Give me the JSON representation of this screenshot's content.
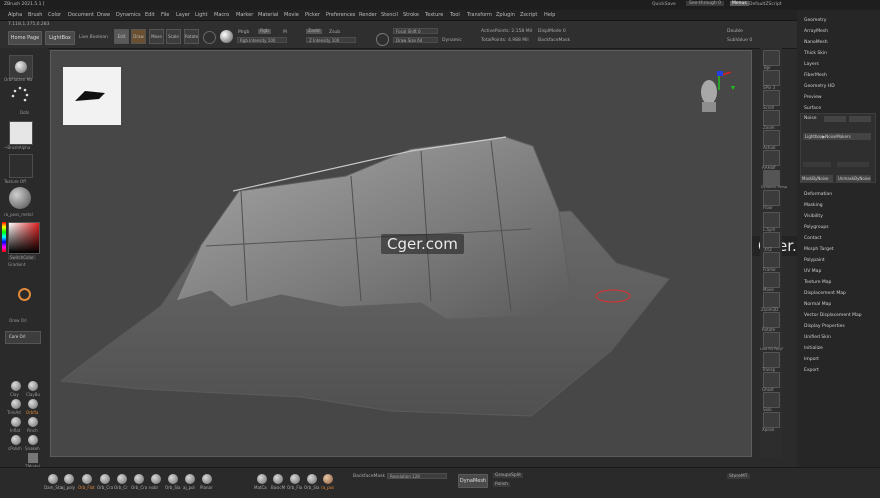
{
  "titlebar": {
    "title": "ZBrush 2021.5.1 [",
    "quicksave": "QuickSave",
    "see_through": "See-through  0",
    "menus": "Menus",
    "script": "DefaultZScript"
  },
  "menubar": [
    "Alpha",
    "Brush",
    "Color",
    "Document",
    "Draw",
    "Dynamics",
    "Edit",
    "File",
    "Layer",
    "Light",
    "Macro",
    "Marker",
    "Material",
    "Movie",
    "Picker",
    "Preferences",
    "Render",
    "Stencil",
    "Stroke",
    "Texture",
    "Tool",
    "Transform",
    "Zplugin",
    "Zscript",
    "Help"
  ],
  "toolbar": {
    "coords": "7.118,1.375,0.283",
    "home_page": "Home Page",
    "lightbox": "LightBox",
    "live_boolean": "Live Boolean",
    "edit": "Edit",
    "draw": "Draw",
    "move": "Move",
    "scale": "Scale",
    "rotate": "Rotate",
    "mrgb": "Mrgb",
    "rgb": "Rgb",
    "m": "M",
    "rgb_intensity": "Rgb Intensity 100",
    "zadd": "Zadd",
    "zsub": "Zsub",
    "z_intensity": "Z Intensity 100",
    "focal_shift": "Focal Shift 0",
    "draw_size": "Draw Size 64",
    "dynamic": "Dynamic",
    "active_points": "ActivePoints: 2.158 Mil",
    "total_points": "TotalPoints: 4.988 Mil",
    "spotlight_mode": "DisplMode 0",
    "backface_mask": "BackfaceMask",
    "double": "Double",
    "subvalue": "SubValue 0"
  },
  "leftpanel": {
    "brush_label": "OrbFlatten Ma",
    "stroke_label": "Dots",
    "alpha_label": "~BrushAlpha",
    "texture_label": "Texture Off",
    "material_label": "ra_poss_metal",
    "switch_color": "SwitchColor",
    "gradient": "Gradient",
    "orbit_label": "Orow Orl",
    "core_label": "Core Orl"
  },
  "left_brushes": [
    {
      "name": "Clay"
    },
    {
      "name": "ClayBu"
    },
    {
      "name": "TrimAd"
    },
    {
      "name": "Orbfla"
    },
    {
      "name": "Inflat"
    },
    {
      "name": "Pinch"
    },
    {
      "name": "cPolish"
    },
    {
      "name": "Snakeh"
    },
    {
      "name": "ZModel"
    },
    {
      "name": "Move"
    },
    {
      "name": "Orb_Cr"
    }
  ],
  "right_tools": [
    "Bpr",
    "SPix 3",
    "Scroll",
    "Zoom",
    "Actual",
    "AAHalf",
    "Dynamic Persp",
    "Floor",
    "L.Sym",
    "XYZ",
    "Frame",
    "Move",
    "Zoom3D",
    "Rotate",
    "Line Fill PolyF",
    "Transp",
    "Ghost",
    "Solo",
    "Xpose"
  ],
  "right_menu": {
    "items": [
      "Geometry",
      "ArrayMesh",
      "NanoMesh",
      "Thick Skin",
      "Layers",
      "FiberMesh",
      "Geometry HD",
      "Preview",
      "Surface"
    ],
    "surface_noise": "Noise",
    "surface_btn": "Lightbox▶NoiseMakers",
    "mask_by_noise": "MaskByNoise",
    "unmask_by_noise": "UnmaskByNoise",
    "items2": [
      "Deformation",
      "Masking",
      "Visibility",
      "Polygroups",
      "Contact",
      "Morph Target",
      "Polypaint",
      "UV Map",
      "Texture Map",
      "Displacement Map",
      "Normal Map",
      "Vector Displacement Map",
      "Display Properties",
      "Unified Skin",
      "Initialize",
      "Import",
      "Export"
    ]
  },
  "bottombar": {
    "materials": [
      "Dam_Sta",
      "aj_poly",
      "Orb_Flat",
      "Orb_Cra",
      "Orb_Cr",
      "Orb_Cra",
      "nobr",
      "Orb_Sla",
      "aj_pol",
      "Orb_Pol",
      "Orb_Rc",
      "Orb_Fla",
      "Planar",
      "MatCa",
      "BasicM",
      "Orb_Fla",
      "Orb_Sla",
      "Orb_Cla",
      "ra_pos"
    ],
    "backface_mask": "BackfaceMask",
    "resolution": "Resolution 128",
    "dynamesh": "DynaMesh",
    "groups_split": "GroupsSplit",
    "polish": "Polish",
    "store_mt": "StoreMT"
  },
  "watermark": {
    "left": "Cger.com",
    "right": "Cger.com"
  },
  "colors": {
    "canvas_bg": "#474747",
    "panel_bg": "#262626",
    "accent_orange": "#e08a3a"
  }
}
